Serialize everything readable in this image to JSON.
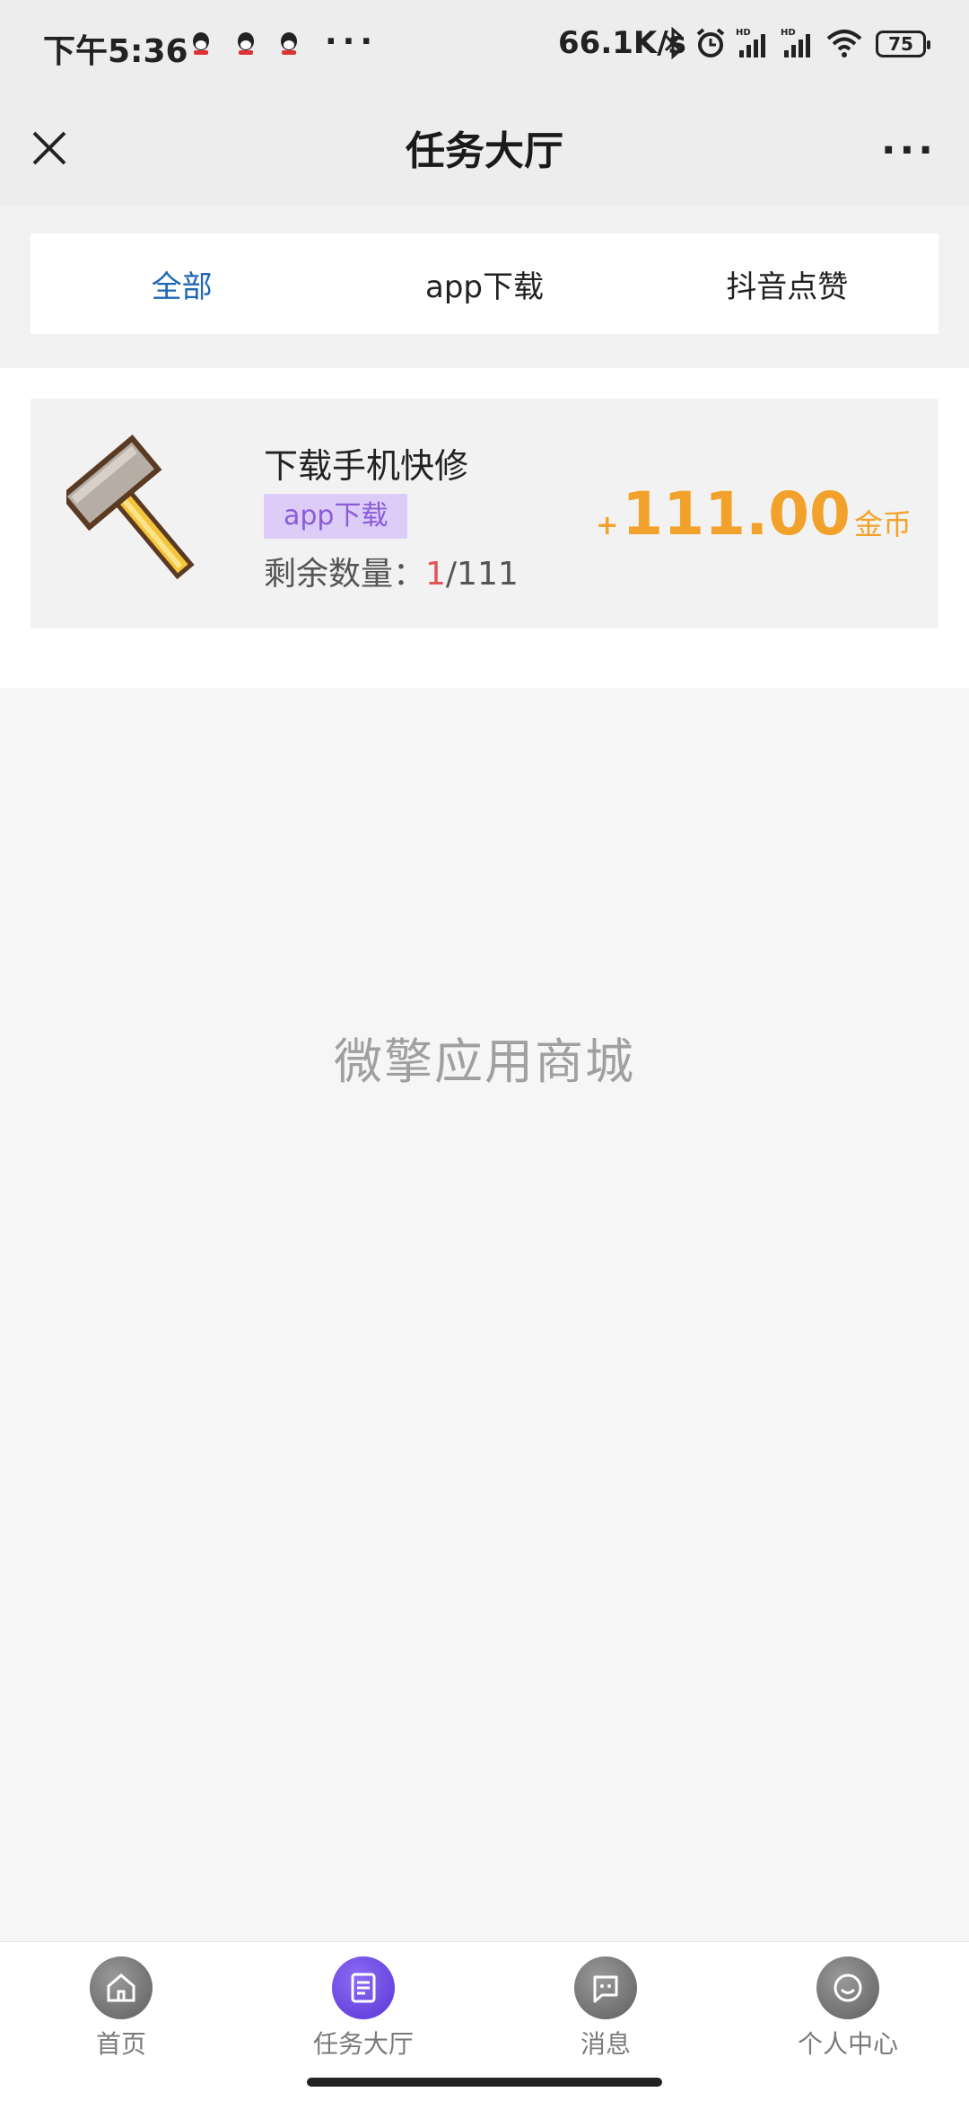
{
  "status_bar": {
    "time": "下午5:36",
    "more": "···",
    "net_speed": "66.1K/s",
    "battery": "75",
    "icons": [
      "qq-icon",
      "qq-icon",
      "qq-icon",
      "bluetooth-icon",
      "alarm-icon",
      "signal-hd-icon",
      "signal-hd-icon",
      "wifi-icon",
      "battery-icon"
    ]
  },
  "nav": {
    "title": "任务大厅",
    "menu": "···"
  },
  "tabs": [
    {
      "label": "全部",
      "active": true
    },
    {
      "label": "app下载",
      "active": false
    },
    {
      "label": "抖音点赞",
      "active": false
    }
  ],
  "tasks": [
    {
      "name": "下载手机快修",
      "tag": "app下载",
      "remain_label": "剩余数量：",
      "remain_current": "1",
      "remain_total": "/111",
      "reward_plus": "+",
      "reward_amount": "111.00",
      "reward_unit": "金币",
      "icon": "hammer-icon"
    }
  ],
  "watermark": "微擎应用商城",
  "bottom_nav": [
    {
      "label": "首页",
      "icon": "home-icon",
      "active": false
    },
    {
      "label": "任务大厅",
      "icon": "task-icon",
      "active": true
    },
    {
      "label": "消息",
      "icon": "message-icon",
      "active": false
    },
    {
      "label": "个人中心",
      "icon": "profile-icon",
      "active": false
    }
  ],
  "colors": {
    "accent_tab": "#1f66b4",
    "reward": "#f2a22a",
    "tag_bg": "#ddccf7",
    "tag_text": "#8a5cd8",
    "remain_highlight": "#e0545c",
    "active_nav": "#6a4be6"
  }
}
